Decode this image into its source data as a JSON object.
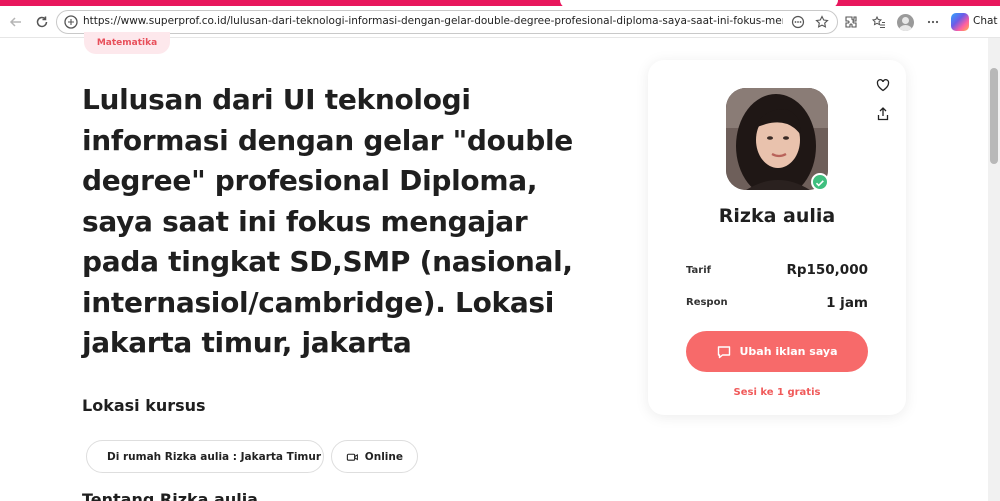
{
  "browser": {
    "url": "https://www.superprof.co.id/lulusan-dari-teknologi-informasi-dengan-gelar-double-degree-profesional-diploma-saya-saat-ini-fokus-mengajar-pada-ting...",
    "chat_label": "Chat"
  },
  "page": {
    "category_badge": "Matematika",
    "headline": "Lulusan dari UI teknologi informasi dengan gelar \"double degree\" profesional Diploma, saya saat ini fokus mengajar pada tingkat SD,SMP (nasional, internasiol/cambridge). Lokasi jakarta timur, jakarta",
    "location_section_title": "Lokasi kursus",
    "location_chips": [
      {
        "label": "Di rumah Rizka aulia : Jakarta Timur",
        "icon": "map-pin-icon"
      },
      {
        "label": "Online",
        "icon": "video-camera-icon"
      }
    ],
    "next_section_title": "Tentang Rizka aulia"
  },
  "card": {
    "tutor_name": "Rizka aulia",
    "rows": [
      {
        "label": "Tarif",
        "value": "Rp150,000"
      },
      {
        "label": "Respon",
        "value": "1 jam"
      }
    ],
    "cta_label": "Ubah iklan saya",
    "free_lesson_label": "Sesi ke 1 gratis"
  },
  "colors": {
    "brand_pink": "#e8175d",
    "cta": "#f76a6a",
    "badge_bg": "#fde8ec",
    "verified": "#3fbf7f"
  }
}
